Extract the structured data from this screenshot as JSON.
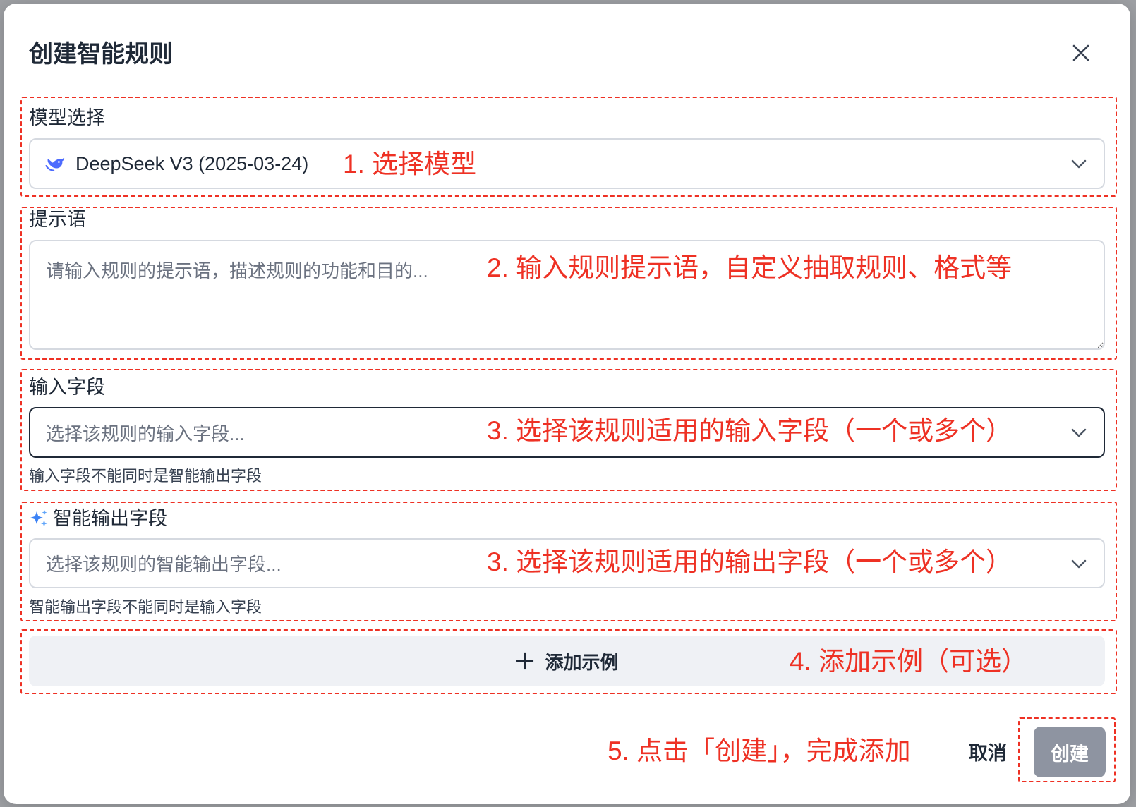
{
  "dialog": {
    "title": "创建智能规则",
    "close_icon": "close-icon"
  },
  "model_field": {
    "label": "模型选择",
    "value": "DeepSeek V3 (2025-03-24)",
    "icon": "deepseek-logo-icon",
    "dropdown_icon": "chevron-down-icon"
  },
  "prompt_field": {
    "label": "提示语",
    "placeholder": "请输入规则的提示语，描述规则的功能和目的..."
  },
  "input_field": {
    "label": "输入字段",
    "placeholder": "选择该规则的输入字段...",
    "helper": "输入字段不能同时是智能输出字段",
    "dropdown_icon": "chevron-down-icon"
  },
  "output_field": {
    "label": "智能输出字段",
    "icon": "sparkle-icon",
    "placeholder": "选择该规则的智能输出字段...",
    "helper": "智能输出字段不能同时是输入字段",
    "dropdown_icon": "chevron-down-icon"
  },
  "add_example": {
    "label": "添加示例",
    "icon": "plus-icon"
  },
  "footer": {
    "cancel_label": "取消",
    "create_label": "创建"
  },
  "annotations": {
    "step1": "1. 选择模型",
    "step2": "2. 输入规则提示语，自定义抽取规则、格式等",
    "step3_input": "3. 选择该规则适用的输入字段（一个或多个）",
    "step3_output": "3. 选择该规则适用的输出字段（一个或多个）",
    "step4": "4. 添加示例（可选）",
    "step5": "5. 点击「创建」，完成添加"
  },
  "colors": {
    "annotation_red": "#ee3124",
    "text_dark": "#1f2937",
    "placeholder_gray": "#6b7280",
    "input_border": "#d5d9e0",
    "focused_border": "#1f2937",
    "add_button_bg": "#eff1f5",
    "create_button_bg": "#8e94a1",
    "deepseek_blue": "#4d6bfe",
    "sparkle_blue": "#3b82f6"
  }
}
